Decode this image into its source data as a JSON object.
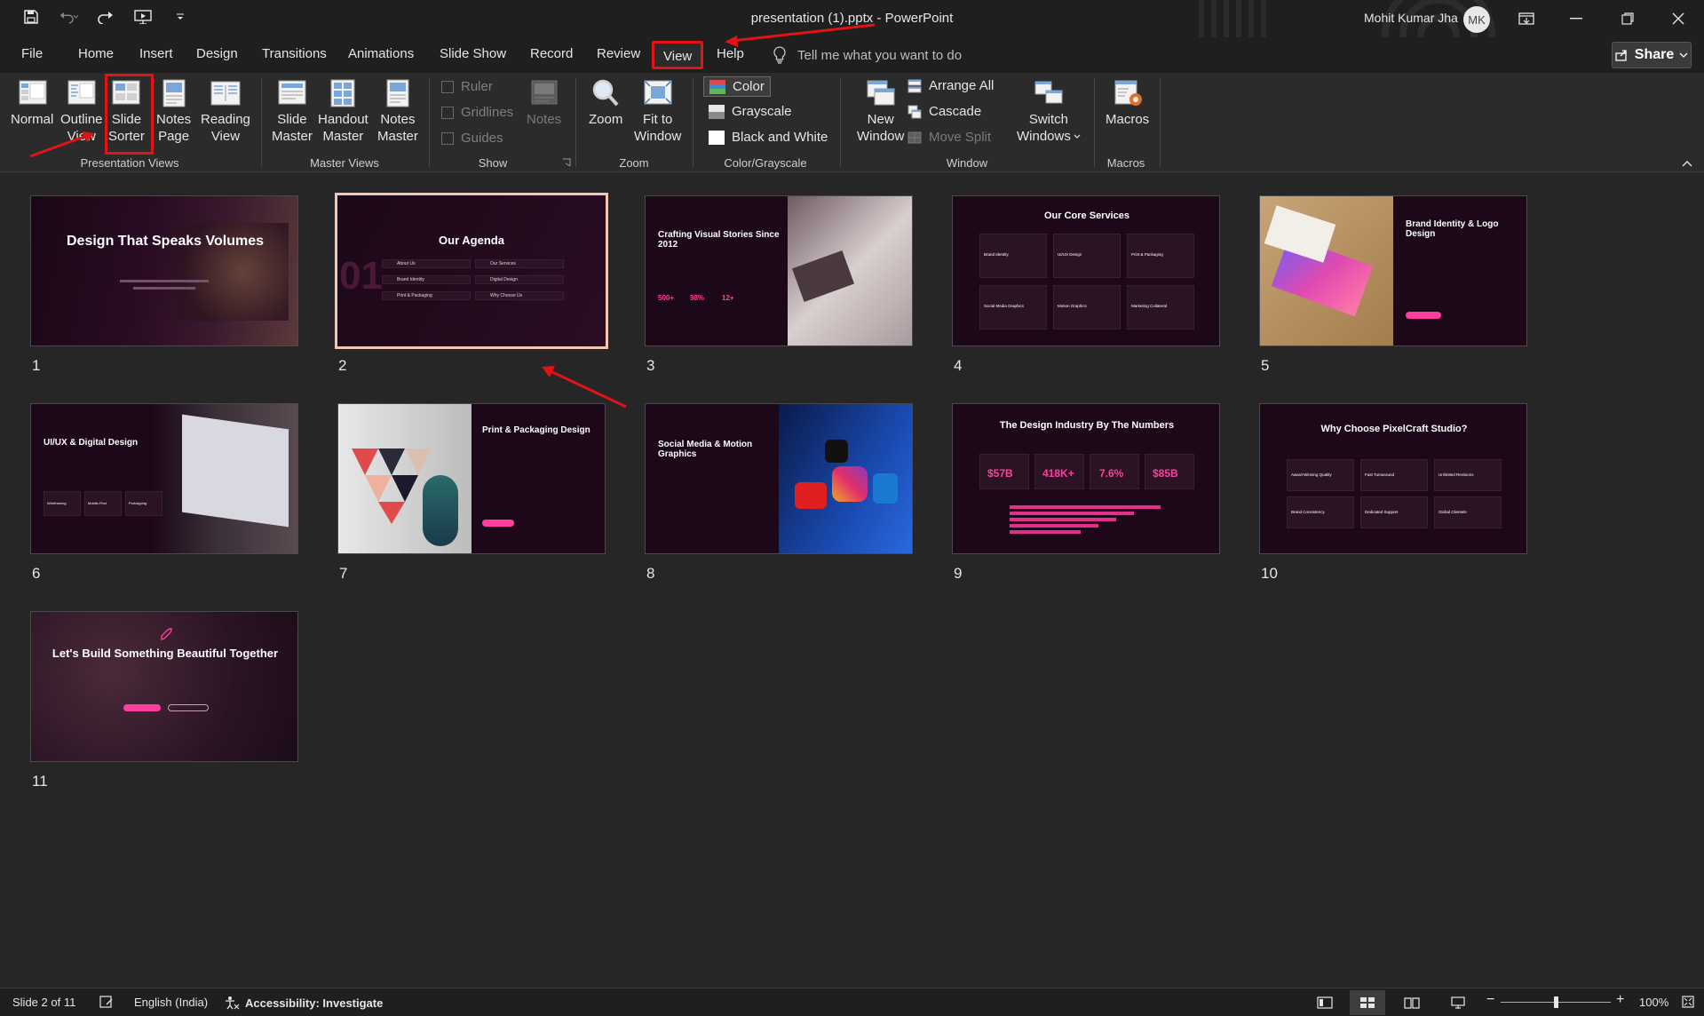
{
  "window": {
    "title": "presentation (1).pptx  -  PowerPoint",
    "user_name": "Mohit Kumar Jha",
    "user_initials": "MK"
  },
  "tabs": [
    "File",
    "Home",
    "Insert",
    "Design",
    "Transitions",
    "Animations",
    "Slide Show",
    "Record",
    "Review",
    "View",
    "Help"
  ],
  "active_tab": "View",
  "tell_me": "Tell me what you want to do",
  "share_label": "Share",
  "ribbon": {
    "presentation_views": {
      "label": "Presentation Views",
      "normal": "Normal",
      "outline_1": "Outline",
      "outline_2": "View",
      "slide_sorter_1": "Slide",
      "slide_sorter_2": "Sorter",
      "notes_page_1": "Notes",
      "notes_page_2": "Page",
      "reading_1": "Reading",
      "reading_2": "View"
    },
    "master_views": {
      "label": "Master Views",
      "slide_1": "Slide",
      "slide_2": "Master",
      "handout_1": "Handout",
      "handout_2": "Master",
      "notes_1": "Notes",
      "notes_2": "Master"
    },
    "show": {
      "label": "Show",
      "ruler": "Ruler",
      "gridlines": "Gridlines",
      "guides": "Guides",
      "notes": "Notes"
    },
    "zoom": {
      "label": "Zoom",
      "zoom": "Zoom",
      "fit_1": "Fit to",
      "fit_2": "Window"
    },
    "color": {
      "label": "Color/Grayscale",
      "color": "Color",
      "grayscale": "Grayscale",
      "bw": "Black and White"
    },
    "window": {
      "label": "Window",
      "new_1": "New",
      "new_2": "Window",
      "arrange_all": "Arrange All",
      "cascade": "Cascade",
      "move_split": "Move Split",
      "switch_1": "Switch",
      "switch_2": "Windows"
    },
    "macros": {
      "label": "Macros",
      "macros": "Macros"
    }
  },
  "slides": {
    "s1": {
      "num": "1",
      "title": "Design That Speaks Volumes"
    },
    "s2": {
      "num": "2",
      "title": "Our Agenda",
      "big": "01",
      "items": [
        "About Us",
        "Our Services",
        "Brand Identity",
        "Digital Design",
        "Print & Packaging",
        "Why Choose Us"
      ]
    },
    "s3": {
      "num": "3",
      "title": "Crafting Visual Stories Since 2012",
      "stats": [
        "500+",
        "98%",
        "12+"
      ]
    },
    "s4": {
      "num": "4",
      "title": "Our Core Services",
      "cards": [
        "Brand Identity",
        "UI/UX Design",
        "Print & Packaging",
        "Social Media Graphics",
        "Motion Graphics",
        "Marketing Collateral"
      ]
    },
    "s5": {
      "num": "5",
      "title": "Brand Identity & Logo Design"
    },
    "s6": {
      "num": "6",
      "title": "UI/UX & Digital Design",
      "items": [
        "Wireframing",
        "Mobile-First",
        "Prototyping"
      ]
    },
    "s7": {
      "num": "7",
      "title": "Print & Packaging Design"
    },
    "s8": {
      "num": "8",
      "title": "Social Media & Motion Graphics"
    },
    "s9": {
      "num": "9",
      "title": "The Design Industry By The Numbers",
      "stats": [
        "$57B",
        "418K+",
        "7.6%",
        "$85B"
      ]
    },
    "s10": {
      "num": "10",
      "title": "Why Choose PixelCraft Studio?",
      "cards": [
        "Award-Winning Quality",
        "Fast Turnaround",
        "Unlimited Revisions",
        "Brand Consistency",
        "Dedicated Support",
        "Global Clientele"
      ]
    },
    "s11": {
      "num": "11",
      "title": "Let's Build Something Beautiful Together"
    }
  },
  "status": {
    "slide_info": "Slide 2 of 11",
    "language": "English (India)",
    "accessibility": "Accessibility: Investigate",
    "zoom": "100%"
  }
}
